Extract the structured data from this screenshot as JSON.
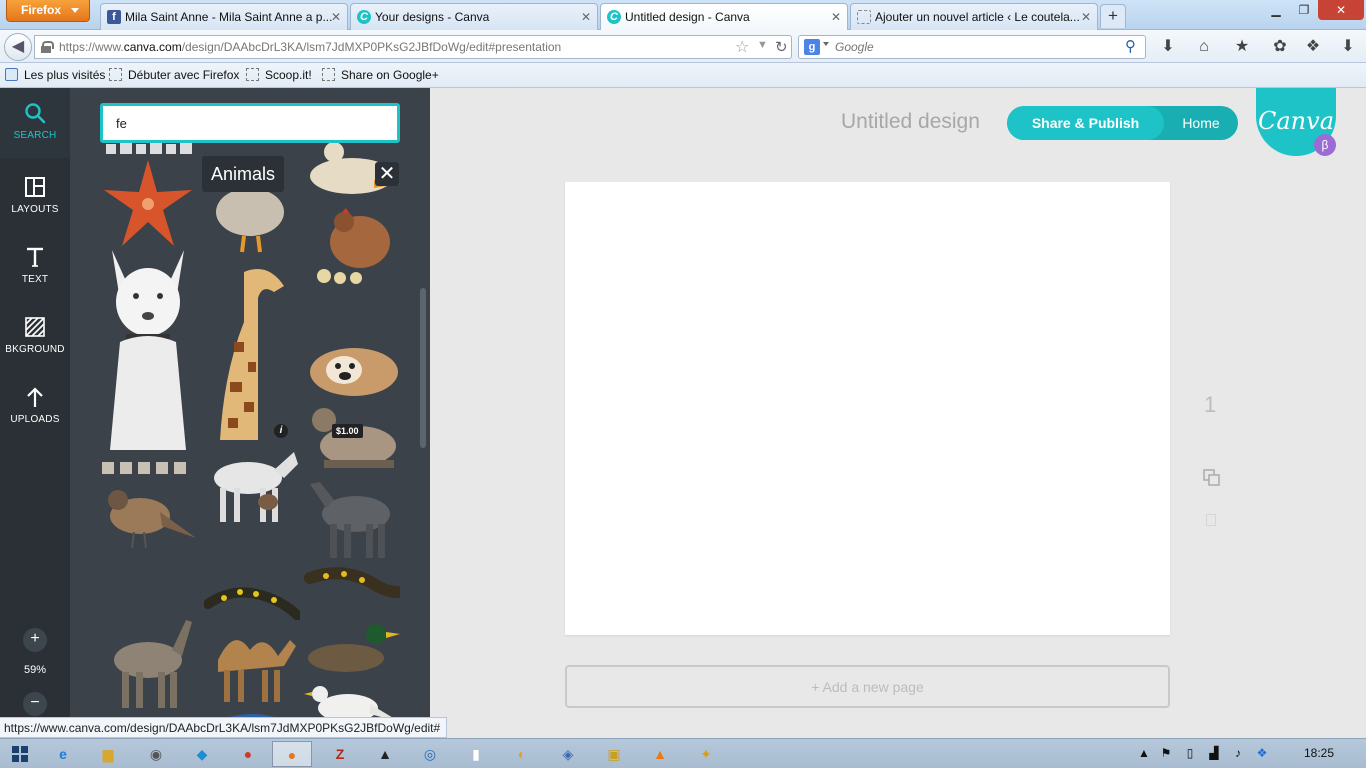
{
  "browser": {
    "menu_button": "Firefox",
    "tabs": [
      {
        "title": "Mila Saint Anne - Mila Saint Anne a p...",
        "favicon": "facebook-icon"
      },
      {
        "title": "Your designs - Canva",
        "favicon": "canva-icon"
      },
      {
        "title": "Untitled design - Canva",
        "favicon": "canva-icon",
        "active": true
      },
      {
        "title": "Ajouter un nouvel article ‹ Le coutela...",
        "favicon": "blank-page-icon"
      }
    ],
    "new_tab": "+",
    "url_prefix": "https://www.",
    "url_domain": "canva.com",
    "url_rest": "/design/DAAbcDrL3KA/lsm7JdMXP0PKsG2JBfDoWg/edit#presentation",
    "search_engine_letter": "g",
    "search_placeholder": "Google",
    "bookmarks": [
      {
        "label": "Les plus visités"
      },
      {
        "label": "Débuter avec Firefox"
      },
      {
        "label": "Scoop.it!"
      },
      {
        "label": "Share on Google+"
      }
    ],
    "status_url": "https://www.canva.com/design/DAAbcDrL3KA/lsm7JdMXP0PKsG2JBfDoWg/edit#"
  },
  "canva": {
    "tools": [
      {
        "label": "SEARCH",
        "icon": "search-icon"
      },
      {
        "label": "LAYOUTS",
        "icon": "layouts-icon"
      },
      {
        "label": "TEXT",
        "icon": "text-icon"
      },
      {
        "label": "BKGROUND",
        "icon": "background-icon"
      },
      {
        "label": "UPLOADS",
        "icon": "upload-icon"
      }
    ],
    "zoom": {
      "in": "+",
      "level": "59%",
      "out": "−"
    },
    "search_value": "fe",
    "collection_tooltip": "Animals",
    "collection_close": "✕",
    "price_tag": "$1.00",
    "info_tag": "i",
    "design_title": "Untitled design",
    "share_button": "Share & Publish",
    "home_button": "Home",
    "logo_text": "Canva",
    "beta_badge": "β",
    "page_number": "1",
    "add_page": "+ Add a new page",
    "accent_color": "#1ec3c7"
  },
  "taskbar": {
    "clock": "18:25",
    "apps": [
      "windows-start",
      "internet-explorer",
      "file-explorer",
      "gimp",
      "twitter",
      "chrome",
      "firefox",
      "filezilla",
      "inkscape",
      "teamviewer",
      "notepad",
      "media-app",
      "virtualbox",
      "archive-tool",
      "vlc",
      "misc-app"
    ]
  }
}
